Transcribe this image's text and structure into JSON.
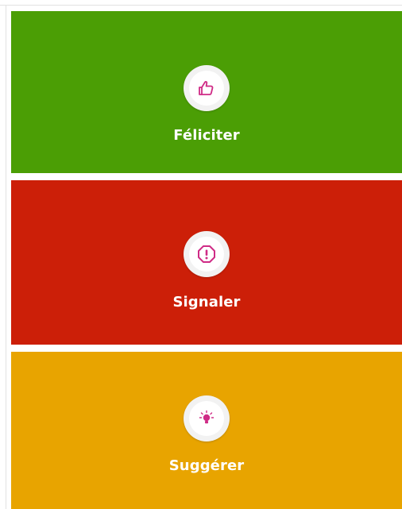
{
  "colors": {
    "green": "#4b9e05",
    "red": "#cc1f08",
    "orange": "#e8a400",
    "icon_accent": "#cf2b86"
  },
  "tiles": [
    {
      "label": "Féliciter",
      "icon": "thumbs-up-icon",
      "color": "#4b9e05"
    },
    {
      "label": "Signaler",
      "icon": "alert-octagon-icon",
      "color": "#cc1f08"
    },
    {
      "label": "Suggérer",
      "icon": "lightbulb-icon",
      "color": "#e8a400"
    }
  ]
}
